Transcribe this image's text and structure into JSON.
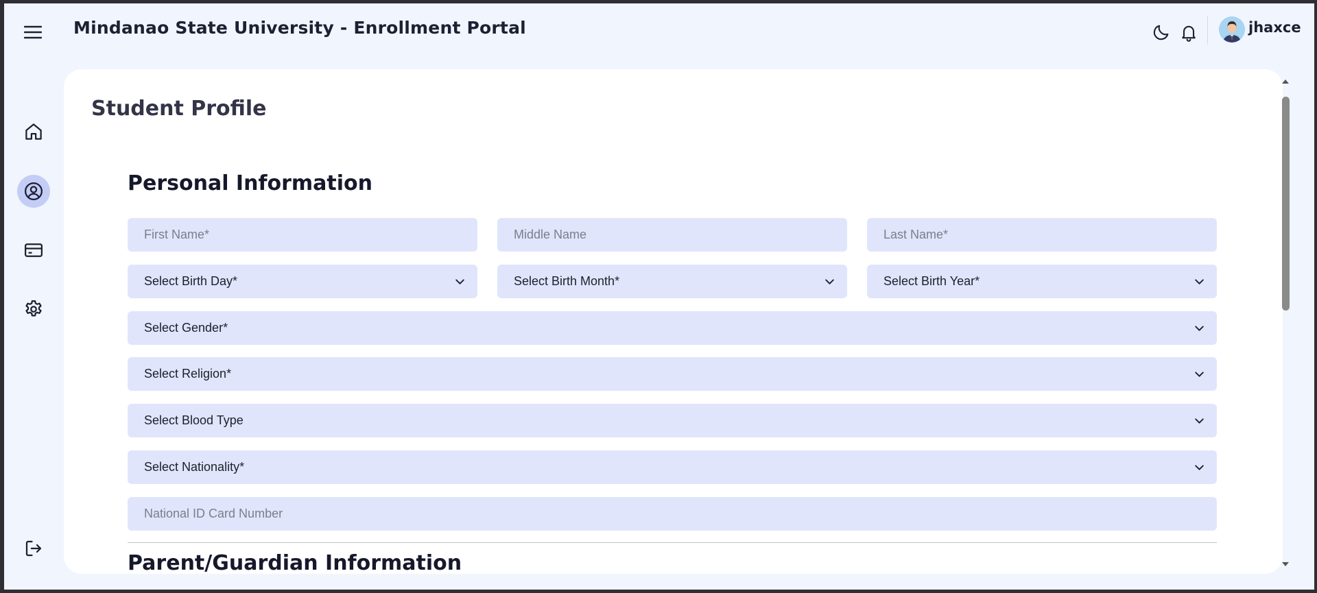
{
  "header": {
    "title": "Mindanao State University - Enrollment Portal",
    "username": "jhaxce"
  },
  "sidebar": {
    "items": [
      {
        "icon": "home-icon"
      },
      {
        "icon": "user-profile-icon",
        "active": true
      },
      {
        "icon": "credit-card-icon"
      },
      {
        "icon": "gear-icon"
      }
    ],
    "logout_icon": "logout-icon"
  },
  "main": {
    "page_title": "Student Profile",
    "personal_section_title": "Personal Information",
    "fields": {
      "first_name": "First Name*",
      "middle_name": "Middle Name",
      "last_name": "Last Name*",
      "birth_day": "Select Birth Day*",
      "birth_month": "Select Birth Month*",
      "birth_year": "Select Birth Year*",
      "gender": "Select Gender*",
      "religion": "Select Religion*",
      "blood_type": "Select Blood Type",
      "nationality": "Select Nationality*",
      "national_id": "National ID Card Number"
    },
    "parent_section_title": "Parent/Guardian Information"
  },
  "colors": {
    "background": "#f1f5fd",
    "field_bg": "#e0e5fc",
    "active_nav": "#c3cdf6",
    "text_dark": "#16182b"
  }
}
